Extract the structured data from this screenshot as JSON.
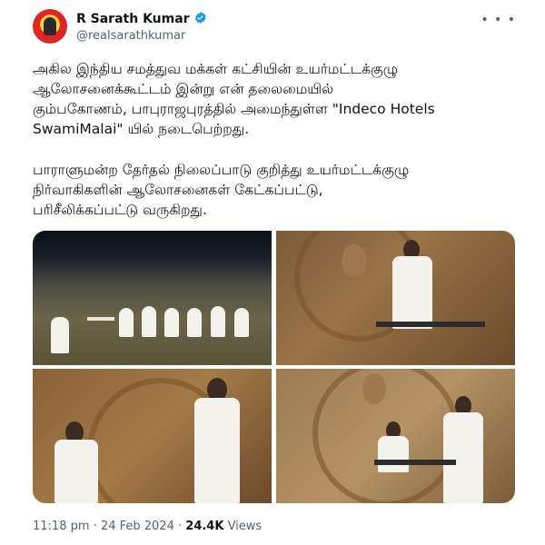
{
  "author": {
    "name": "R Sarath Kumar",
    "handle": "@realsarathkumar",
    "verified": true
  },
  "more_icon": "more-horizontal-icon",
  "tweet": {
    "paragraph1": "அகில இந்திய சமத்துவ மக்கள் கட்சியின் உயர்மட்டக்குழு\nஆலோசனைக்கூட்டம் இன்று என் தலைமையில்\nகும்பகோணம், பாபுராஜபுரத்தில் அமைந்துள்ள \"Indeco Hotels\nSwamiMalai\" யில் நடைபெற்றது.",
    "paragraph2": "பாராளுமன்ற தேர்தல் நிலைப்பாடு குறித்து உயர்மட்டக்குழு\nநிர்வாகிகளின் ஆலோசனைகள் கேட்கப்பட்டு,\nபரிசீலிக்கப்பட்டு வருகிறது."
  },
  "meta": {
    "time": "11:18 pm",
    "separator": "·",
    "date": "24 Feb 2024",
    "views_count": "24.4K",
    "views_label": "Views"
  },
  "colors": {
    "text": "#0f1419",
    "secondary": "#536471",
    "verified": "#1d9bf0"
  }
}
